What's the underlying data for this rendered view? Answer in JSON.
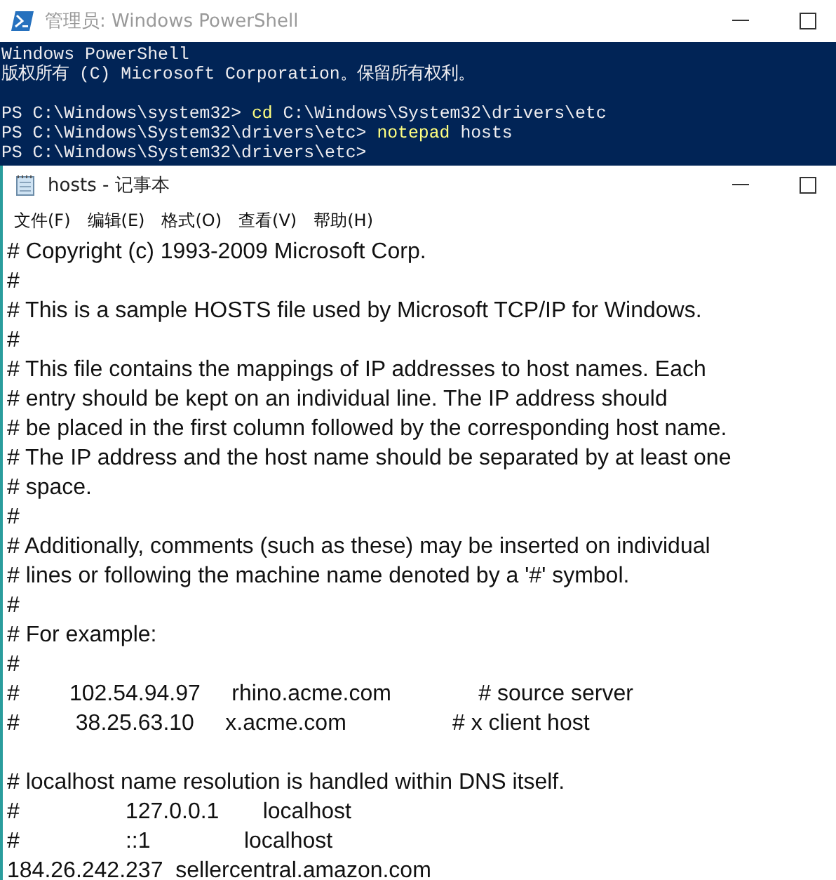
{
  "powershell": {
    "title": "管理员: Windows PowerShell",
    "console_lines": [
      {
        "kind": "output",
        "text": "Windows PowerShell"
      },
      {
        "kind": "output",
        "text": "版权所有 (C) Microsoft Corporation。保留所有权利。"
      },
      {
        "kind": "blank"
      },
      {
        "kind": "command",
        "prompt": "PS C:\\Windows\\system32>",
        "command": "cd",
        "arguments": "C:\\Windows\\System32\\drivers\\etc"
      },
      {
        "kind": "command",
        "prompt": "PS C:\\Windows\\System32\\drivers\\etc>",
        "command": "notepad",
        "arguments": "hosts"
      },
      {
        "kind": "prompt",
        "prompt": "PS C:\\Windows\\System32\\drivers\\etc>"
      }
    ]
  },
  "notepad": {
    "title": "hosts - 记事本",
    "menu": [
      "文件(F)",
      "编辑(E)",
      "格式(O)",
      "查看(V)",
      "帮助(H)"
    ],
    "lines": [
      "# Copyright (c) 1993-2009 Microsoft Corp.",
      "#",
      "# This is a sample HOSTS file used by Microsoft TCP/IP for Windows.",
      "#",
      "# This file contains the mappings of IP addresses to host names. Each",
      "# entry should be kept on an individual line. The IP address should",
      "# be placed in the first column followed by the corresponding host name.",
      "# The IP address and the host name should be separated by at least one",
      "# space.",
      "#",
      "# Additionally, comments (such as these) may be inserted on individual",
      "# lines or following the machine name denoted by a '#' symbol.",
      "#",
      "# For example:",
      "#",
      "#        102.54.94.97     rhino.acme.com              # source server",
      "#         38.25.63.10     x.acme.com                 # x client host",
      {
        "kind": "blank"
      },
      "# localhost name resolution is handled within DNS itself.",
      "#                 127.0.0.1       localhost",
      "#                 ::1               localhost",
      "184.26.242.237  sellercentral.amazon.com"
    ]
  }
}
